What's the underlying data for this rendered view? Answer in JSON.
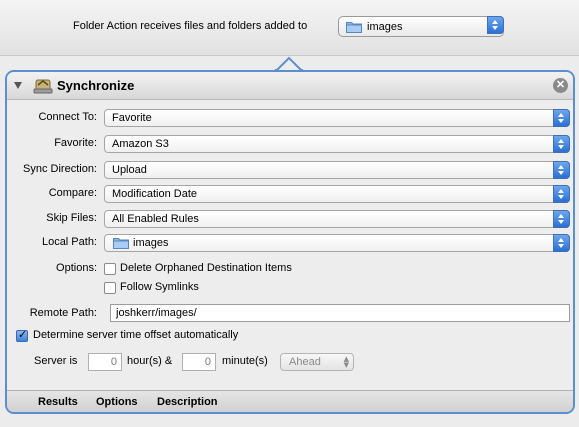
{
  "header": {
    "label": "Folder Action receives files and folders added to",
    "folder": "images",
    "icons": {
      "folder": "folder-icon",
      "stepper": "popup-stepper-icon"
    }
  },
  "action": {
    "title": "Synchronize",
    "icons": {
      "disclosure": "disclosure-triangle-icon",
      "action": "synchronize-action-icon",
      "close": "close-icon"
    },
    "close_glyph": "✕"
  },
  "fields": {
    "connect_to": {
      "label": "Connect To:",
      "value": "Favorite"
    },
    "favorite": {
      "label": "Favorite:",
      "value": "Amazon S3"
    },
    "sync_direction": {
      "label": "Sync Direction:",
      "value": "Upload"
    },
    "compare": {
      "label": "Compare:",
      "value": "Modification Date"
    },
    "skip_files": {
      "label": "Skip Files:",
      "value": "All Enabled Rules"
    },
    "local_path": {
      "label": "Local Path:",
      "value": "images"
    }
  },
  "options": {
    "label": "Options:",
    "delete_orphaned": {
      "label": "Delete Orphaned Destination Items",
      "checked": false
    },
    "follow_symlinks": {
      "label": "Follow Symlinks",
      "checked": false
    }
  },
  "remote_path": {
    "label": "Remote Path:",
    "value": "joshkerr/images/"
  },
  "time_offset": {
    "auto_label": "Determine server time offset automatically",
    "auto_checked": true,
    "server_is_label": "Server is",
    "hours_value": "0",
    "hours_label": "hour(s) &",
    "minutes_value": "0",
    "minutes_label": "minute(s)",
    "direction": "Ahead"
  },
  "footer": {
    "tabs": [
      "Results",
      "Options",
      "Description"
    ]
  },
  "colors": {
    "panel_border": "#5b8fd0",
    "stepper": "#2a6fd6"
  }
}
